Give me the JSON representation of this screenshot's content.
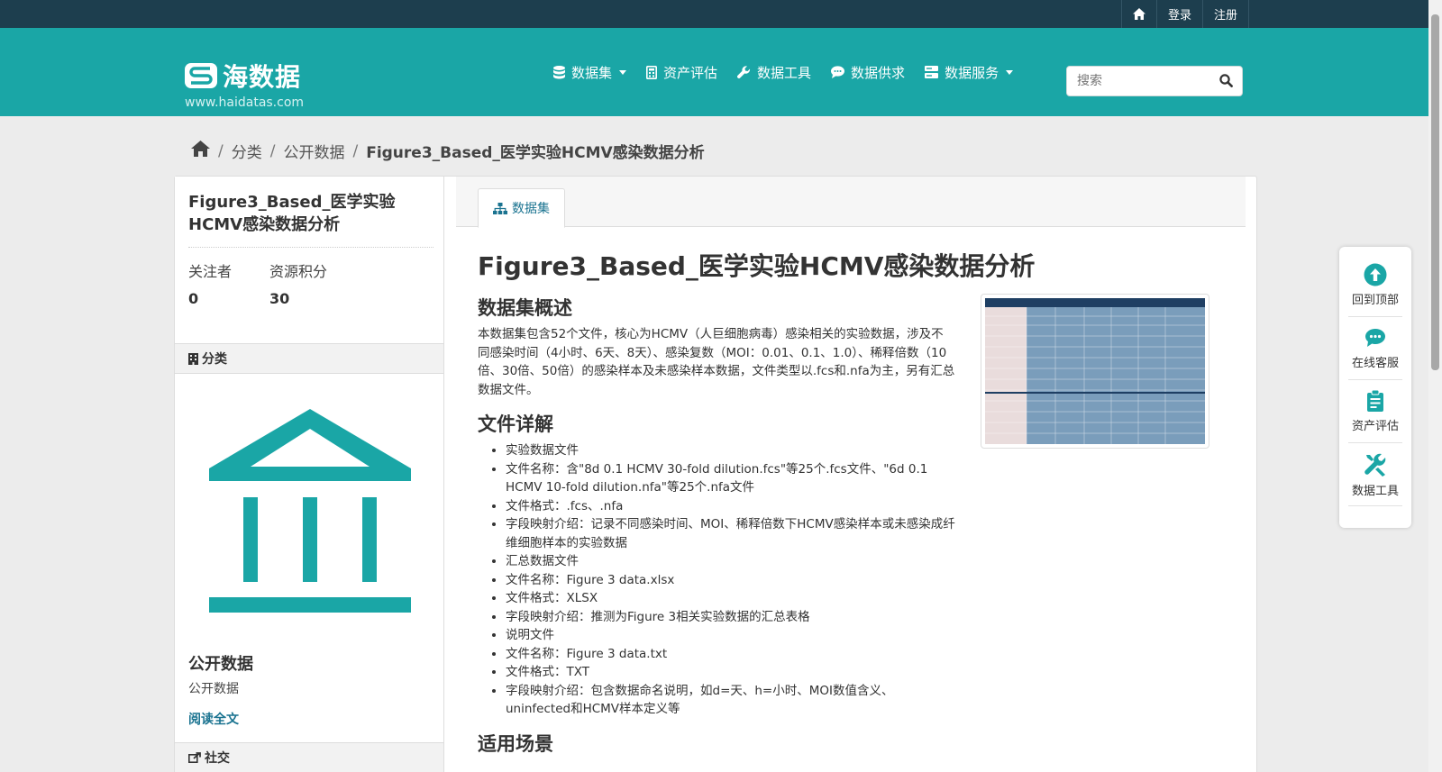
{
  "topbar": {
    "login": "登录",
    "register": "注册"
  },
  "site": {
    "brand": "海数据",
    "url": "www.haidatas.com"
  },
  "nav": {
    "items": [
      {
        "label": "数据集"
      },
      {
        "label": "资产评估"
      },
      {
        "label": "数据工具"
      },
      {
        "label": "数据供求"
      },
      {
        "label": "数据服务"
      }
    ]
  },
  "search": {
    "placeholder": "搜索"
  },
  "breadcrumb": {
    "items": [
      "分类",
      "公开数据"
    ],
    "current": "Figure3_Based_医学实验HCMV感染数据分析"
  },
  "aside": {
    "title": "Figure3_Based_医学实验HCMV感染数据分析",
    "stats": [
      {
        "label": "关注者",
        "value": "0"
      },
      {
        "label": "资源积分",
        "value": "30"
      }
    ],
    "category_heading": "分类",
    "category_name": "公开数据",
    "category_desc": "公开数据",
    "read_more": "阅读全文",
    "social_heading": "社交"
  },
  "main": {
    "tab": "数据集",
    "title": "Figure3_Based_医学实验HCMV感染数据分析",
    "overview_heading": "数据集概述",
    "overview_text": "本数据集包含52个文件，核心为HCMV（人巨细胞病毒）感染相关的实验数据，涉及不同感染时间（4小时、6天、8天）、感染复数（MOI：0.01、0.1、1.0）、稀释倍数（10倍、30倍、50倍）的感染样本及未感染样本数据，文件类型以.fcs和.nfa为主，另有汇总数据文件。",
    "files_heading": "文件详解",
    "file_items": [
      "实验数据文件",
      "文件名称：含\"8d 0.1 HCMV 30-fold dilution.fcs\"等25个.fcs文件、\"6d 0.1 HCMV 10-fold dilution.nfa\"等25个.nfa文件",
      "文件格式：.fcs、.nfa",
      "字段映射介绍：记录不同感染时间、MOI、稀释倍数下HCMV感染样本或未感染成纤维细胞样本的实验数据",
      "汇总数据文件",
      "文件名称：Figure 3 data.xlsx",
      "文件格式：XLSX",
      "字段映射介绍：推测为Figure 3相关实验数据的汇总表格",
      "说明文件",
      "文件名称：Figure 3 data.txt",
      "文件格式：TXT",
      "字段映射介绍：包含数据命名说明，如d=天、h=小时、MOI数值含义、uninfected和HCMV样本定义等"
    ],
    "usage_heading": "适用场景"
  },
  "float_bar": {
    "items": [
      {
        "label": "回到顶部"
      },
      {
        "label": "在线客服"
      },
      {
        "label": "资产评估"
      },
      {
        "label": "数据工具"
      }
    ]
  },
  "colors": {
    "topbar": "#1d3e4e",
    "brand": "#1aa6a6",
    "link": "#1a7390"
  }
}
